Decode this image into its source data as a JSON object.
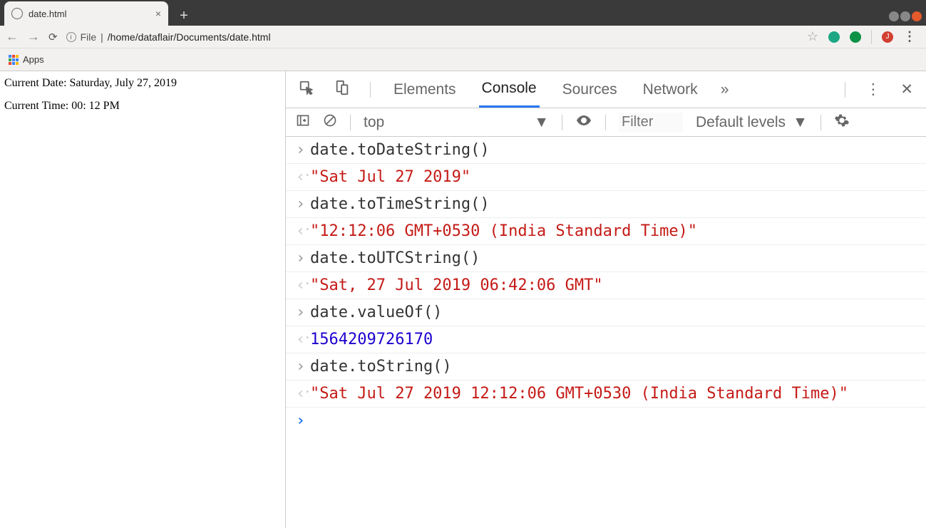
{
  "window": {
    "tab_title": "date.html",
    "url_scheme": "File",
    "url_path": "/home/dataflair/Documents/date.html",
    "apps_label": "Apps",
    "avatar_letter": "J"
  },
  "page": {
    "line1": "Current Date: Saturday, July 27, 2019",
    "line2": "Current Time: 00: 12 PM"
  },
  "devtools": {
    "tabs": {
      "elements": "Elements",
      "console": "Console",
      "sources": "Sources",
      "network": "Network"
    },
    "toolbar": {
      "context": "top",
      "filter_placeholder": "Filter",
      "levels": "Default levels"
    },
    "logs": [
      {
        "dir": "in",
        "type": "code",
        "text": "date.toDateString()"
      },
      {
        "dir": "out",
        "type": "str",
        "text": "\"Sat Jul 27 2019\""
      },
      {
        "dir": "in",
        "type": "code",
        "text": "date.toTimeString()"
      },
      {
        "dir": "out",
        "type": "str",
        "text": "\"12:12:06 GMT+0530 (India Standard Time)\""
      },
      {
        "dir": "in",
        "type": "code",
        "text": "date.toUTCString()"
      },
      {
        "dir": "out",
        "type": "str",
        "text": "\"Sat, 27 Jul 2019 06:42:06 GMT\""
      },
      {
        "dir": "in",
        "type": "code",
        "text": "date.valueOf()"
      },
      {
        "dir": "out",
        "type": "num",
        "text": "1564209726170"
      },
      {
        "dir": "in",
        "type": "code",
        "text": "date.toString()"
      },
      {
        "dir": "out",
        "type": "str",
        "text": "\"Sat Jul 27 2019 12:12:06 GMT+0530 (India Standard Time)\""
      }
    ]
  }
}
